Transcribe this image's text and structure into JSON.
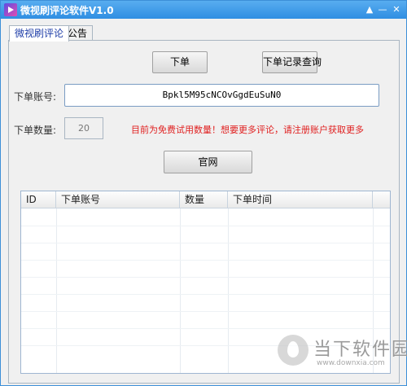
{
  "window": {
    "title": "微视刷评论软件V1.0",
    "controls": [
      "▲",
      "—",
      "✕"
    ]
  },
  "tabs": [
    {
      "label": "微视刷评论",
      "active": true
    },
    {
      "label": "公告",
      "active": false
    }
  ],
  "actions": {
    "order_label": "下单",
    "query_label": "下单记录查询",
    "website_label": "官网"
  },
  "form": {
    "account_label": "下单账号:",
    "account_value": "Bpkl5M95cNCOvGgdEuSuN0",
    "quantity_label": "下单数量:",
    "quantity_value": "20",
    "notice": "目前为免费试用数量！想要更多评论，请注册账户获取更多"
  },
  "table": {
    "columns": [
      "ID",
      "下单账号",
      "数量",
      "下单时间"
    ],
    "rows": []
  },
  "watermark": {
    "cn": "当下软件园",
    "en": "www.downxia.com"
  },
  "colors": {
    "title_bar": "#2f8ee2",
    "notice": "#e02020",
    "active_tab_text": "#1f3ea8"
  }
}
